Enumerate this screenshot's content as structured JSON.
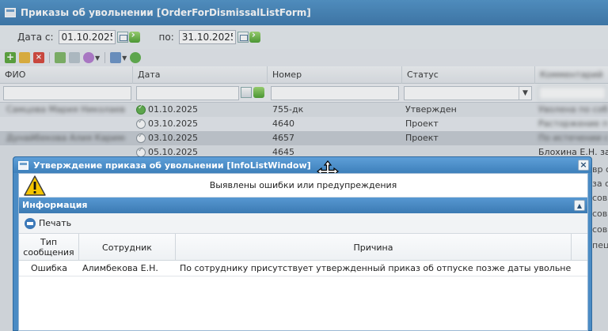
{
  "main_window": {
    "title": "Приказы об увольнении [OrderForDismissalListForm]",
    "date_from_label": "Дата с:",
    "date_from_value": "01.10.2025",
    "date_to_label": "по:",
    "date_to_value": "31.10.2025"
  },
  "grid": {
    "columns": [
      "ФИО",
      "Дата",
      "Номер",
      "Статус",
      "Комментарий"
    ],
    "rows": [
      {
        "fio": "Самцова Мария Николаевна",
        "date": "01.10.2025",
        "number": "755-дк",
        "status": "Утвержден",
        "status_icon": "approved-icon",
        "comment": "Уволена по собственному желанию"
      },
      {
        "fio": "",
        "date": "03.10.2025",
        "number": "4640",
        "status": "Проект",
        "status_icon": "pending-icon",
        "comment": "Расторжение по соглашению"
      },
      {
        "fio": "Дунайбекова Алия Каримовна",
        "date": "03.10.2025",
        "number": "4657",
        "status": "Проект",
        "status_icon": "pending-icon",
        "comment": "По истечении срока договора"
      },
      {
        "fio": "",
        "date": "05.10.2025",
        "number": "4645",
        "status": "",
        "status_icon": "pending-icon",
        "comment": "Блохина Е.Н. зав л"
      }
    ],
    "right_snippets": [
      "вр с",
      "за от",
      "совм",
      "совм",
      "совм",
      "пец"
    ]
  },
  "dialog": {
    "title": "Утверждение приказа об увольнении [InfoListWindow]",
    "message": "Выявлены ошибки или предупреждения",
    "panel_title": "Информация",
    "print_label": "Печать",
    "columns": {
      "type": "Тип сообщения",
      "employee": "Сотрудник",
      "reason": "Причина"
    },
    "rows": [
      {
        "type": "Ошибка",
        "employee": "Алимбекова Е.Н.",
        "reason": "По сотруднику присутствует утвержденный приказ об отпуске позже даты увольнения"
      }
    ]
  },
  "colors": {
    "title_blue": "#3e80bb",
    "approved_green": "#5fb04a",
    "warning_yellow": "#f5c400"
  }
}
